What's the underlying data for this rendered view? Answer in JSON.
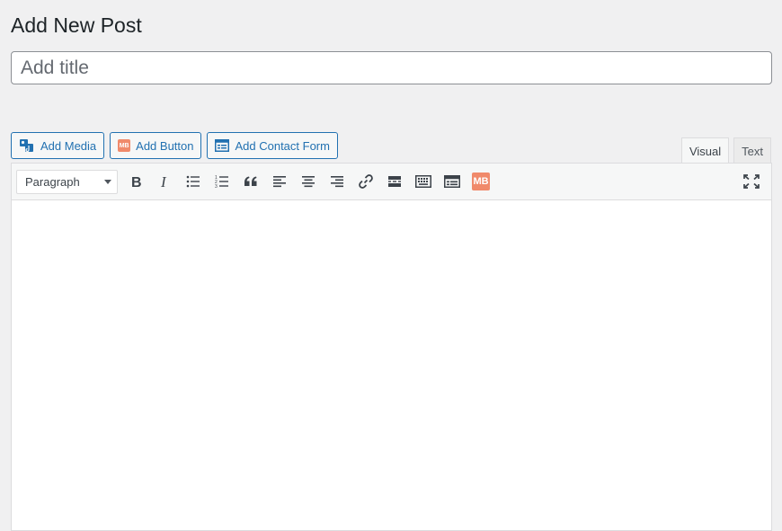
{
  "page": {
    "title": "Add New Post"
  },
  "title_field": {
    "placeholder": "Add title",
    "value": ""
  },
  "media_buttons": [
    {
      "label": "Add Media",
      "icon": "add-media-icon"
    },
    {
      "label": "Add Button",
      "icon": "mb-badge-icon",
      "badge": "MB"
    },
    {
      "label": "Add Contact Form",
      "icon": "contact-form-icon"
    }
  ],
  "editor_tabs": [
    {
      "label": "Visual",
      "active": true
    },
    {
      "label": "Text",
      "active": false
    }
  ],
  "toolbar": {
    "format_value": "Paragraph",
    "buttons": [
      "bold-icon",
      "italic-icon",
      "bulleted-list-icon",
      "numbered-list-icon",
      "blockquote-icon",
      "align-left-icon",
      "align-center-icon",
      "align-right-icon",
      "link-icon",
      "read-more-icon",
      "toolbar-toggle-icon",
      "form-icon",
      "mb-icon",
      "fullscreen-icon"
    ],
    "mb_badge": "MB"
  },
  "colors": {
    "accent": "#2271b1",
    "mb_orange": "#f08a6b",
    "background": "#f0f0f1"
  }
}
